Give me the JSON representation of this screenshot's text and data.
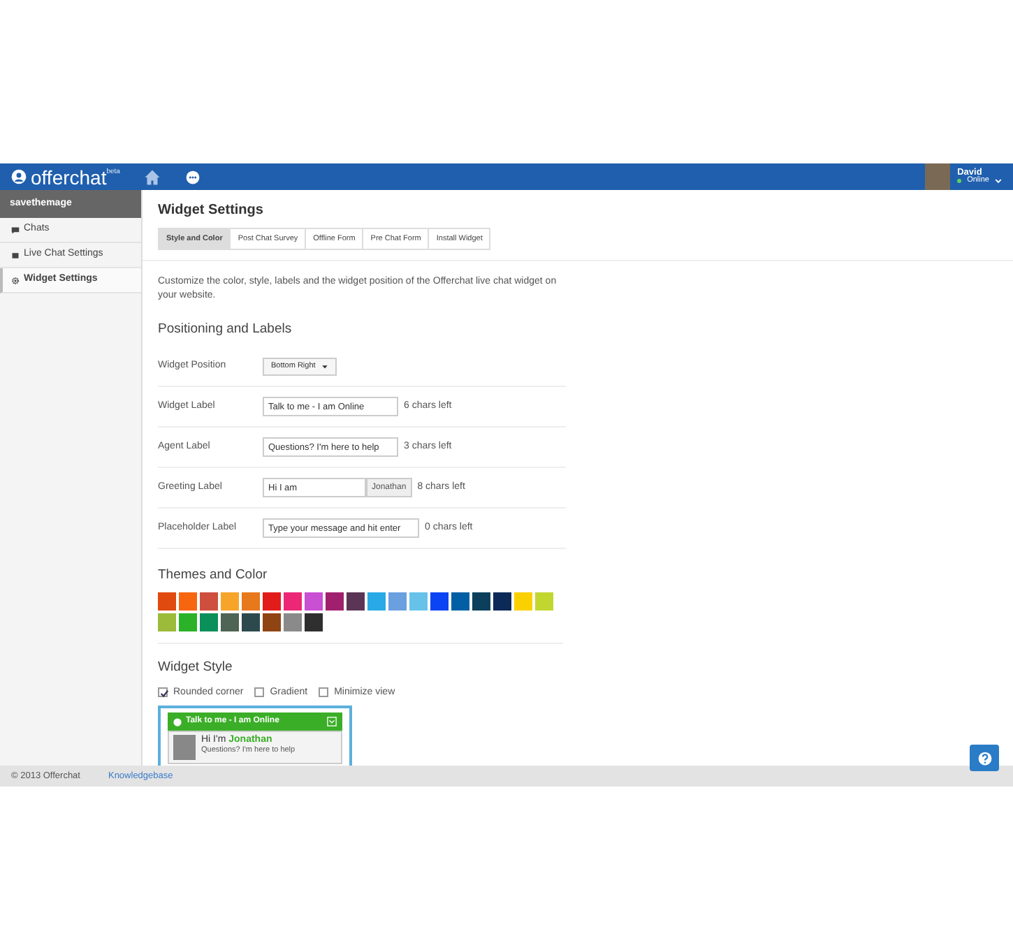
{
  "navbar": {
    "brand": "offerchat",
    "brand_badge": "beta",
    "user": {
      "name": "David",
      "status": "Online"
    }
  },
  "sidebar": {
    "header": "savethemage",
    "items": [
      {
        "label": "Chats",
        "selected": false
      },
      {
        "label": "Live Chat Settings",
        "selected": false
      },
      {
        "label": "Widget Settings",
        "selected": true
      }
    ]
  },
  "page": {
    "title": "Widget Settings",
    "tabs": [
      {
        "label": "Style and Color",
        "selected": true
      },
      {
        "label": "Post Chat Survey",
        "selected": false
      },
      {
        "label": "Offline Form",
        "selected": false
      },
      {
        "label": "Pre Chat Form",
        "selected": false
      },
      {
        "label": "Install Widget",
        "selected": false
      }
    ],
    "description": "Customize the color, style, labels and the widget position of the Offerchat live chat widget on your website."
  },
  "positioning": {
    "title": "Positioning and Labels",
    "rows": [
      {
        "kind": "dropdown",
        "label": "Widget Position",
        "value": "Bottom Right"
      },
      {
        "kind": "input",
        "label": "Widget Label",
        "value": "Talk to me - I am Online",
        "hint": "6 chars left"
      },
      {
        "kind": "input",
        "label": "Agent Label",
        "value": "Questions? I'm here to help",
        "hint": "3 chars left"
      },
      {
        "kind": "input_addon",
        "label": "Greeting Label",
        "value": "Hi I am",
        "addon": "Jonathan",
        "hint": "8 chars left"
      },
      {
        "kind": "input",
        "label": "Placeholder Label",
        "value": "Type your message and hit enter",
        "hint": "0 chars left"
      }
    ]
  },
  "themes": {
    "title": "Themes and Color",
    "swatches": [
      {
        "color": "#e04a0f"
      },
      {
        "color": "#f7660f"
      },
      {
        "color": "#cf4f3f"
      },
      {
        "color": "#f7a52a"
      },
      {
        "color": "#e8781c"
      },
      {
        "color": "#e21b1b"
      },
      {
        "color": "#ec2775"
      },
      {
        "color": "#c94fd3"
      },
      {
        "color": "#a1206d"
      },
      {
        "color": "#5b3555"
      },
      {
        "color": "#29a9e6"
      },
      {
        "color": "#6a9fe0"
      },
      {
        "color": "#67c2ea"
      },
      {
        "color": "#0b44f2"
      },
      {
        "color": "#035fa5"
      },
      {
        "color": "#0b3f5c"
      },
      {
        "color": "#0c2a58"
      },
      {
        "color": "#fbd000"
      },
      {
        "color": "#c1d72f"
      },
      {
        "color": "#9cbb3a"
      },
      {
        "color": "#2bb228"
      },
      {
        "color": "#0b8f5b"
      },
      {
        "color": "#4e6455"
      },
      {
        "color": "#2c4a4d"
      },
      {
        "color": "#8f4414"
      },
      {
        "color": "#8a8a8a"
      },
      {
        "color": "#2f2f2f"
      }
    ]
  },
  "widget_style": {
    "title": "Widget Style",
    "options": [
      {
        "label": "Rounded corner",
        "checked": true
      },
      {
        "label": "Gradient",
        "checked": false
      },
      {
        "label": "Minimize view",
        "checked": false
      }
    ],
    "preview": {
      "header": "Talk to me - I am Online",
      "greeting": "Hi I'm **Jonathan**",
      "message": "Questions? I'm here to help"
    }
  },
  "footer": {
    "copyright": "© 2013 Offerchat",
    "link": "Knowledgebase"
  }
}
